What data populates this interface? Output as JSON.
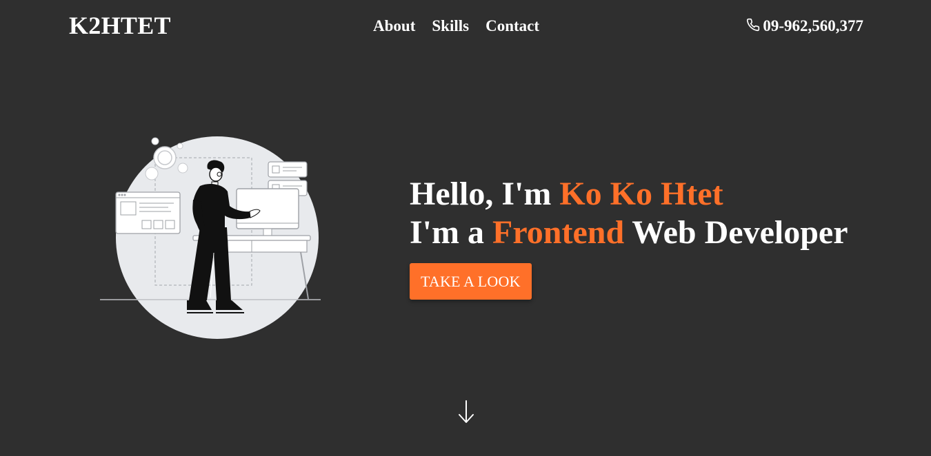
{
  "navbar": {
    "logo": "K2HTET",
    "links": [
      "About",
      "Skills",
      "Contact"
    ],
    "phone": "09-962,560,377",
    "phone_icon": "phone-icon"
  },
  "hero": {
    "greeting_prefix": "Hello, I'm ",
    "name": "Ko Ko Htet",
    "role_prefix": "I'm a ",
    "role_highlight": "Frontend",
    "role_suffix": " Web Developer",
    "cta_label": "TAKE A LOOK",
    "illustration_icon": "developer-at-desk-illustration",
    "scroll_icon": "arrow-down-icon"
  },
  "colors": {
    "background": "#2f2f2f",
    "accent": "#ff7029",
    "text": "#ffffff"
  }
}
